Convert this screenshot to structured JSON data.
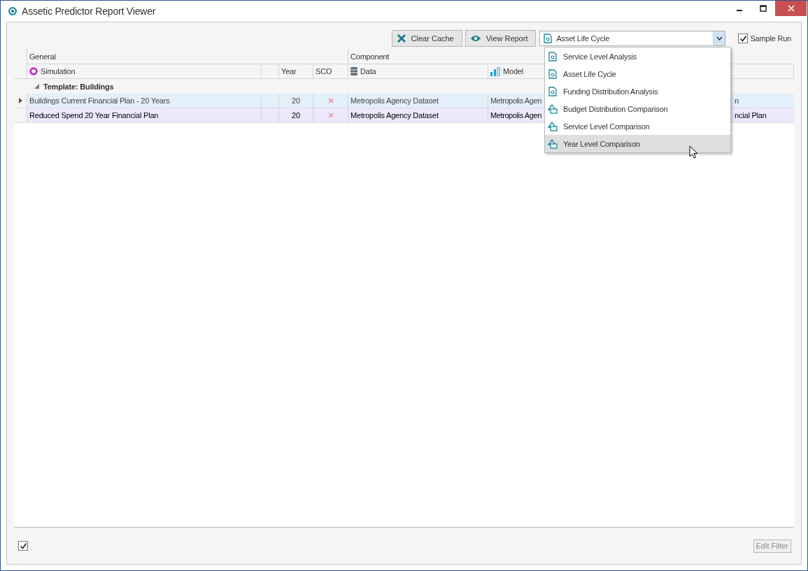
{
  "window": {
    "title": "Assetic Predictor Report Viewer"
  },
  "toolbar": {
    "buttons": [
      {
        "label": "Clear Cache",
        "kind": "clear"
      },
      {
        "label": "View Report",
        "kind": "view"
      }
    ],
    "report_select": {
      "value": "Asset Life Cycle",
      "expanded": true
    },
    "sample_run": {
      "label": "Sample Run",
      "checked": true
    }
  },
  "dropdown_options": [
    {
      "label": "Service Level Analysis",
      "kind": "report",
      "selected": false
    },
    {
      "label": "Asset Life Cycle",
      "kind": "report",
      "selected": false
    },
    {
      "label": "Funding Distribution Analysis",
      "kind": "report",
      "selected": false
    },
    {
      "label": "Budget Distribution Comparison",
      "kind": "comparison",
      "selected": false
    },
    {
      "label": "Service Level Comparison",
      "kind": "comparison",
      "selected": false
    },
    {
      "label": "Year Level Comparison",
      "kind": "comparison",
      "selected": true
    }
  ],
  "grid": {
    "bands": [
      "General",
      "Component"
    ],
    "columns": [
      {
        "label": "Simulation",
        "kind": "simulation"
      },
      {
        "label": "Year",
        "kind": "plain"
      },
      {
        "label": "SCO",
        "kind": "plain"
      },
      {
        "label": "Data",
        "kind": "data"
      },
      {
        "label": "Model",
        "kind": "model"
      }
    ],
    "group": {
      "label": "Template: Buildings",
      "expanded": true
    },
    "rows": [
      {
        "simulation": "Buildings Current Financial Plan - 20 Years",
        "year": "20",
        "sco": false,
        "data": "Metropolis Agency Dataset",
        "model": "Metropolis Agen",
        "column_8": "n",
        "focused": true,
        "selected": false
      },
      {
        "simulation": "Reduced Spend 20 Year Financial Plan",
        "year": "20",
        "sco": false,
        "data": "Metropolis Agency Dataset",
        "model": "Metropolis Agen",
        "column_8": "ncial Plan",
        "focused": false,
        "selected": true
      }
    ]
  },
  "footer": {
    "checkbox": {
      "checked": true
    },
    "edit_filter": {
      "label": "Edit Filter",
      "disabled": true
    }
  }
}
